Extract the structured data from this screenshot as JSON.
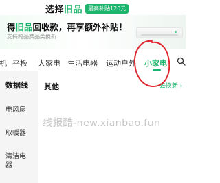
{
  "header": {
    "title_pre": "选择",
    "title_highlight": "旧品",
    "badge": "最高补贴120元"
  },
  "banner": {
    "headline_pre": "得",
    "headline_highlight": "旧品",
    "headline_post": "回收款，再享额外补贴！",
    "subtitle": "支持跨品牌品类换新"
  },
  "tabs": {
    "items": [
      {
        "label": "机",
        "active": false
      },
      {
        "label": "平板",
        "active": false
      },
      {
        "label": "大家电",
        "active": false
      },
      {
        "label": "生活电器",
        "active": false
      },
      {
        "label": "运动户外",
        "active": false
      },
      {
        "label": "小家电",
        "active": true
      }
    ]
  },
  "sidebar": {
    "items": [
      {
        "label": "数据线",
        "active": true
      },
      {
        "label": "电风扇",
        "active": false
      },
      {
        "label": "取暖器",
        "active": false
      },
      {
        "label": "清洁电\n器",
        "active": false
      }
    ]
  },
  "content": {
    "subtab": "其他",
    "switch_link": "去换新 ›"
  },
  "watermark": "线报酷-new.xianbao.fun",
  "colors": {
    "accent": "#1bb56c",
    "annotation": "#e0262f"
  }
}
